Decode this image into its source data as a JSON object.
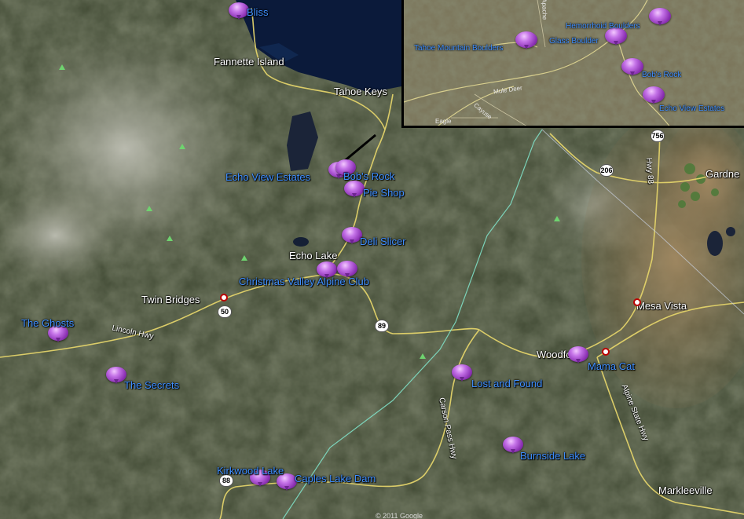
{
  "places": {
    "bliss": "Bliss",
    "fannette_island": "Fannette Island",
    "tahoe_keys": "Tahoe Keys",
    "echo_view_estates": "Echo View Estates",
    "bobs_rock": "Bob's Rock",
    "pie_shop": "Pie Shop",
    "deli_slicer": "Deli Slicer",
    "echo_lake": "Echo Lake",
    "christmas_valley": "Christmas Valley Alpine Club",
    "twin_bridges": "Twin Bridges",
    "the_ghosts": "The Ghosts",
    "the_secrets": "The Secrets",
    "lincoln_hwy": "Lincoln Hwy",
    "woodfords": "Woodfords",
    "mama_cat": "Mama Cat",
    "lost_and_found": "Lost and Found",
    "burnside_lake": "Burnside Lake",
    "kirkwood_lake": "Kirkwood Lake",
    "caples_lake_dam": "Caples Lake Dam",
    "markleeville": "Markleeville",
    "mesa_vista": "Mesa Vista",
    "gardnerville": "Gardne",
    "carson_pass_hwy": "Carson Pass Hwy",
    "alpine_state_hwy": "Alpine State Hwy",
    "hwy_88": "Hwy 88"
  },
  "shields": {
    "us50": "50",
    "ca89": "89",
    "ca88": "88",
    "r206": "206",
    "r756": "756"
  },
  "inset": {
    "tahoe_mountain_boulders": "Tahoe Mountain Boulders",
    "glass_boulder": "Glass Boulder",
    "hemorrhoid_boulders": "Hemorrhoid Boulders",
    "bobs_rock": "Bob's Rock",
    "echo_view_estates": "Echo View Estates",
    "mule_deer": "Mule Deer",
    "eagle": "Eagle",
    "apache": "Apache",
    "cayuse": "Cayuse"
  },
  "copyright": "© 2011 Google",
  "colors": {
    "pin": "#9b3fc8",
    "label": "#3f8fff",
    "water": "#0b1a3a",
    "terrain": "#4a5238"
  }
}
